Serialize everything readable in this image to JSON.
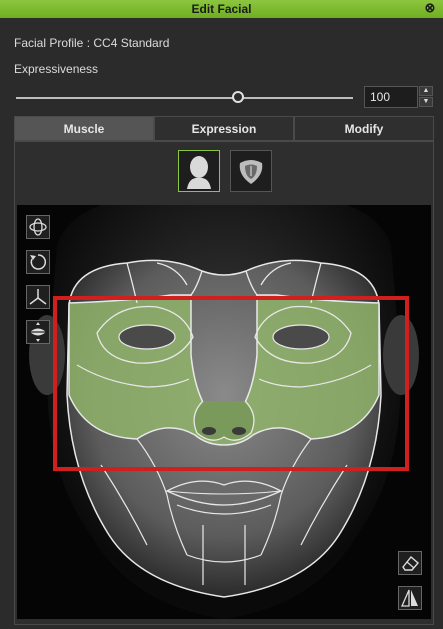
{
  "window": {
    "title": "Edit Facial",
    "close_icon": "close-circle-icon"
  },
  "profile": {
    "label": "Facial Profile : CC4 Standard"
  },
  "expressiveness": {
    "label": "Expressiveness",
    "value": "100",
    "slider_fraction": 0.67
  },
  "tabs": [
    {
      "label": "Muscle",
      "active": true
    },
    {
      "label": "Expression",
      "active": false
    },
    {
      "label": "Modify",
      "active": false
    }
  ],
  "mode_buttons": [
    {
      "icon": "head-icon",
      "selected": true
    },
    {
      "icon": "tongue-icon",
      "selected": false
    }
  ],
  "left_tools": [
    "orbit-icon",
    "rotate-icon",
    "move-axes-icon",
    "mouth-icon"
  ],
  "right_tools": [
    "eraser-icon",
    "mirror-icon"
  ],
  "colors": {
    "accent": "#8cc63f",
    "selection": "#d01f1f",
    "muscle_highlight": "#8fb36a"
  }
}
